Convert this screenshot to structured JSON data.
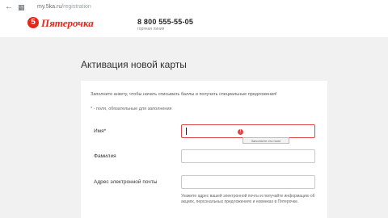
{
  "browser": {
    "back_icon": "arrow-left-icon",
    "grid_icon": "apps-grid-icon",
    "url_host": "my.5ka.ru",
    "url_path": "/registration"
  },
  "header": {
    "logo_mark": "5",
    "logo_text": "Пятерочка",
    "phone": "8 800 555-55-05",
    "phone_caption": "горячая линия"
  },
  "page": {
    "title": "Активация новой карты"
  },
  "form": {
    "intro": "Заполните анкету, чтобы начать списывать баллы и получать специальные предложения!",
    "required_note": "* - поля, обязательные для заполнения",
    "fields": [
      {
        "label": "Имя*",
        "value": ""
      },
      {
        "label": "Фамилия",
        "value": ""
      },
      {
        "label": "Адрес электронной почты",
        "value": ""
      }
    ],
    "error_marker": "!",
    "error_tooltip": "Заполните это поле",
    "email_hint": "Укажите адрес вашей электронной почты и получайте информацию об акциях, персональных предложениях и новинках в Пятерочке."
  },
  "colors": {
    "brand_red": "#e3271b",
    "error_red": "#d94a4a"
  }
}
